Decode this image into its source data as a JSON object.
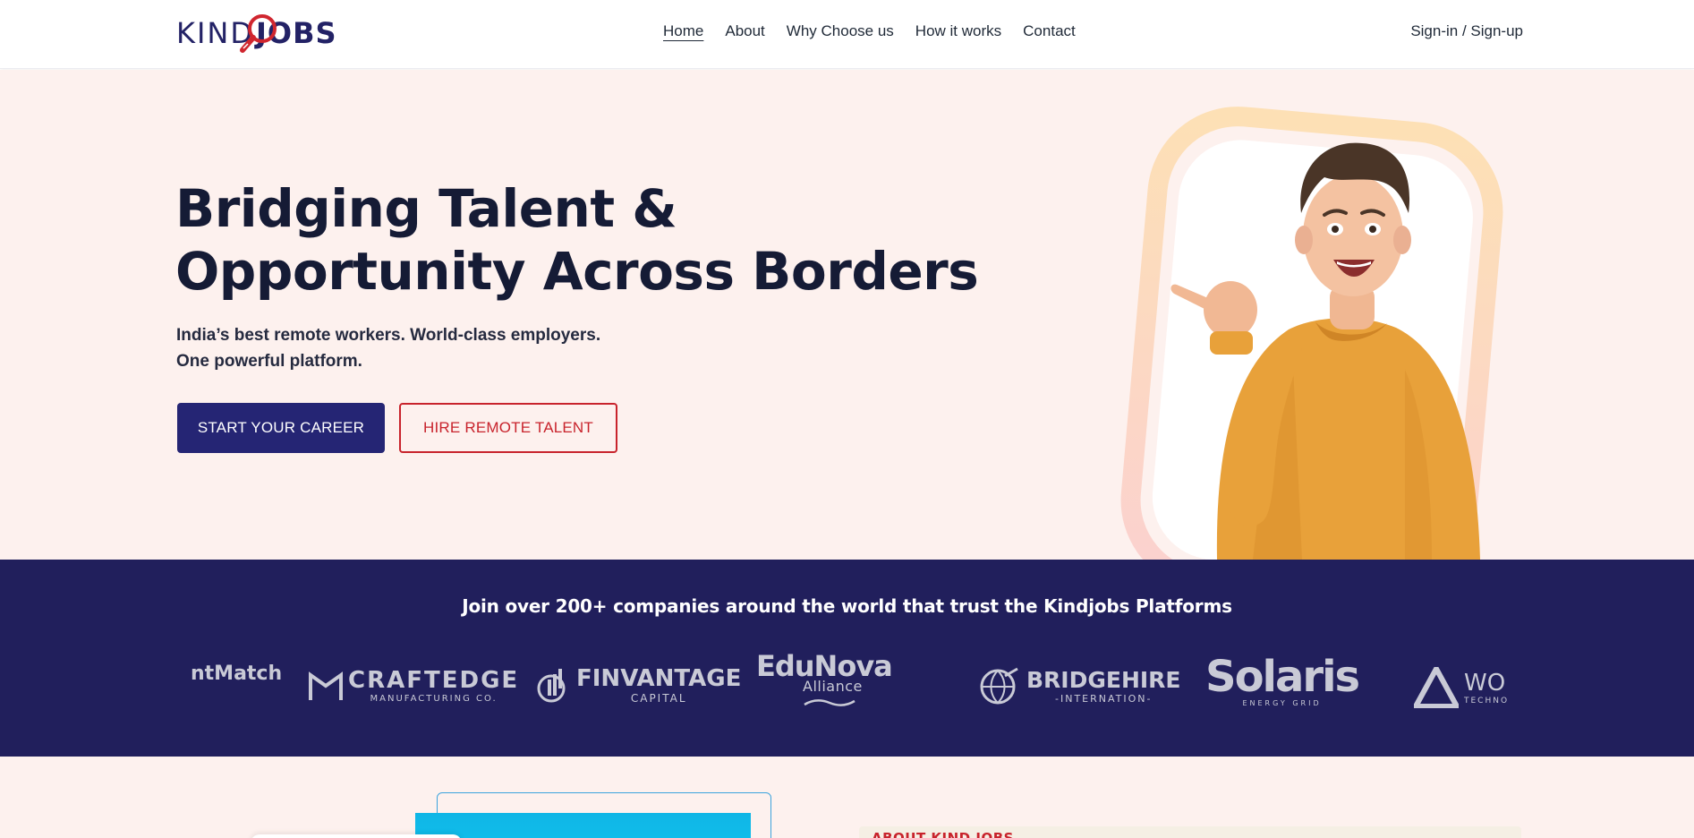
{
  "brand": {
    "logo_text_left": "KIND",
    "logo_text_right": "JOBS"
  },
  "nav": {
    "items": [
      {
        "label": "Home",
        "active": true
      },
      {
        "label": "About",
        "active": false
      },
      {
        "label": "Why Choose us",
        "active": false
      },
      {
        "label": "How it works",
        "active": false
      },
      {
        "label": "Contact",
        "active": false
      }
    ],
    "auth_label": "Sign-in / Sign-up"
  },
  "hero": {
    "title_line1": "Bridging Talent &",
    "title_line2": "Opportunity Across Borders",
    "subtitle_line1": "India’s best remote workers. World-class employers.",
    "subtitle_line2": "One powerful platform.",
    "primary_cta": "START YOUR CAREER",
    "secondary_cta": "HIRE REMOTE TALENT"
  },
  "trust": {
    "heading": "Join over 200+ companies around the world that trust the Kindjobs Platforms",
    "logos": [
      {
        "name": "ntMatch",
        "tag": ""
      },
      {
        "name": "CRAFTEDGE",
        "tag": "MANUFACTURING CO."
      },
      {
        "name": "FINVANTAGE",
        "tag": "CAPITAL"
      },
      {
        "name": "EduNova",
        "tag": "Alliance"
      },
      {
        "name": "BRIDGEHIRE",
        "tag": "-INTERNATION-"
      },
      {
        "name": "Solaris",
        "tag": "ENERGY GRID"
      },
      {
        "name": "WO",
        "tag": "TECHNO"
      }
    ]
  },
  "about": {
    "eyebrow": "ABOUT KIND JOBS"
  },
  "colors": {
    "navy": "#252574",
    "deep_navy": "#211f5c",
    "accent_red": "#c8232c",
    "hero_bg": "#fdf1ee",
    "sweater": "#e8a13a"
  }
}
